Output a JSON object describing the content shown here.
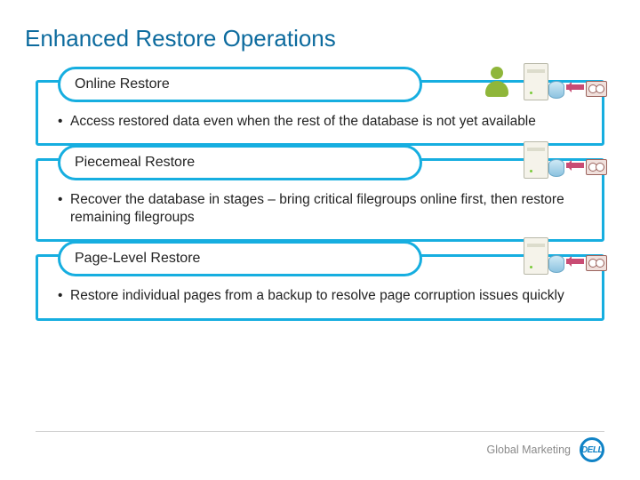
{
  "title": "Enhanced Restore Operations",
  "cards": [
    {
      "pill": "Online Restore",
      "bullet": "Access restored data even when the rest of the database is not yet available",
      "art": "person-server"
    },
    {
      "pill": "Piecemeal Restore",
      "bullet": "Recover the database in stages – bring critical filegroups online first, then restore remaining filegroups",
      "art": "server"
    },
    {
      "pill": "Page-Level Restore",
      "bullet": "Restore individual pages from a backup to resolve page corruption issues quickly",
      "art": "server"
    }
  ],
  "footer": {
    "label": "Global Marketing",
    "brand": "DELL"
  }
}
